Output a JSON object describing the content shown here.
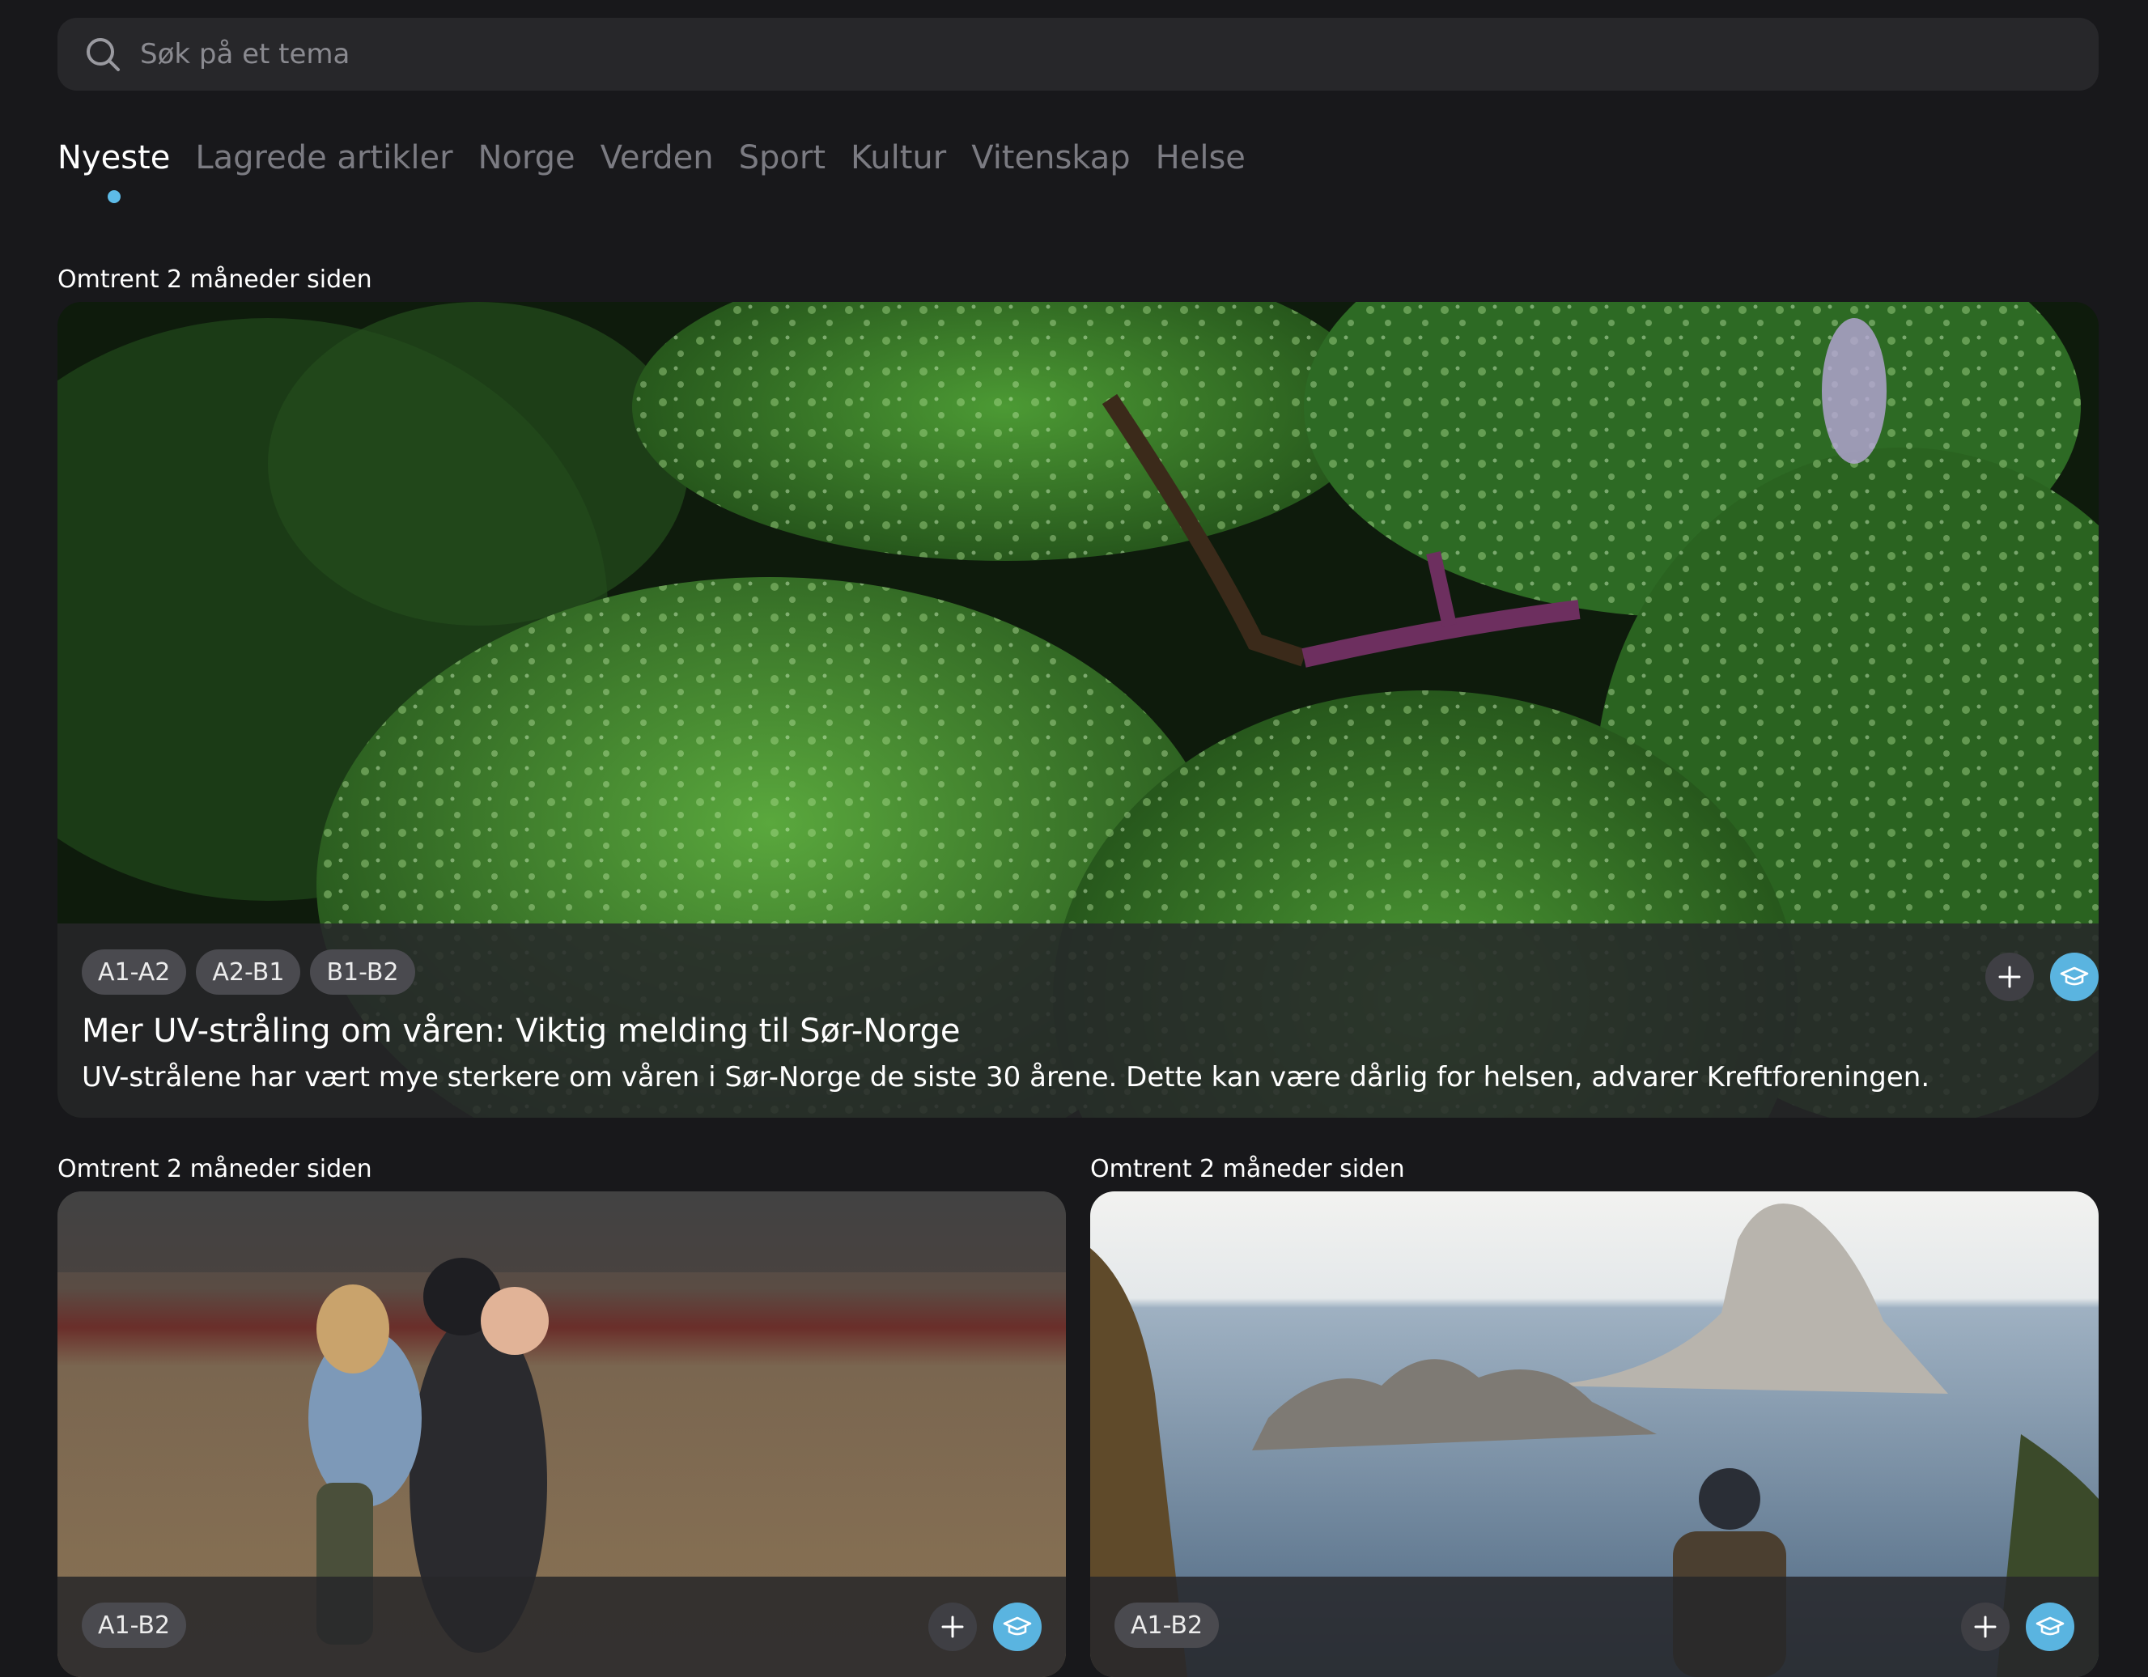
{
  "search": {
    "placeholder": "Søk på et tema",
    "icon": "search-icon"
  },
  "tabs": [
    {
      "label": "Nyeste",
      "active": true
    },
    {
      "label": "Lagrede artikler"
    },
    {
      "label": "Norge"
    },
    {
      "label": "Verden"
    },
    {
      "label": "Sport"
    },
    {
      "label": "Kultur"
    },
    {
      "label": "Vitenskap"
    },
    {
      "label": "Helse"
    }
  ],
  "accent_color": "#5dbbe8",
  "featured": {
    "time": "Omtrent 2 måneder siden",
    "levels": [
      "A1-A2",
      "A2-B1",
      "B1-B2"
    ],
    "title": "Mer UV-stråling om våren: Viktig melding til Sør-Norge",
    "description": "UV-strålene har vært mye sterkere om våren i Sør-Norge de siste 30 årene. Dette kan være dårlig for helsen, advarer Kreftforeningen.",
    "image": "green leaves with water droplets"
  },
  "articles": [
    {
      "time": "Omtrent 2 måneder siden",
      "levels": [
        "A1-B2"
      ],
      "image": "couple in a field, woman on man's back"
    },
    {
      "time": "Omtrent 2 måneder siden",
      "levels": [
        "A1-B2"
      ],
      "image": "man looking at rocky island over the sea"
    }
  ]
}
